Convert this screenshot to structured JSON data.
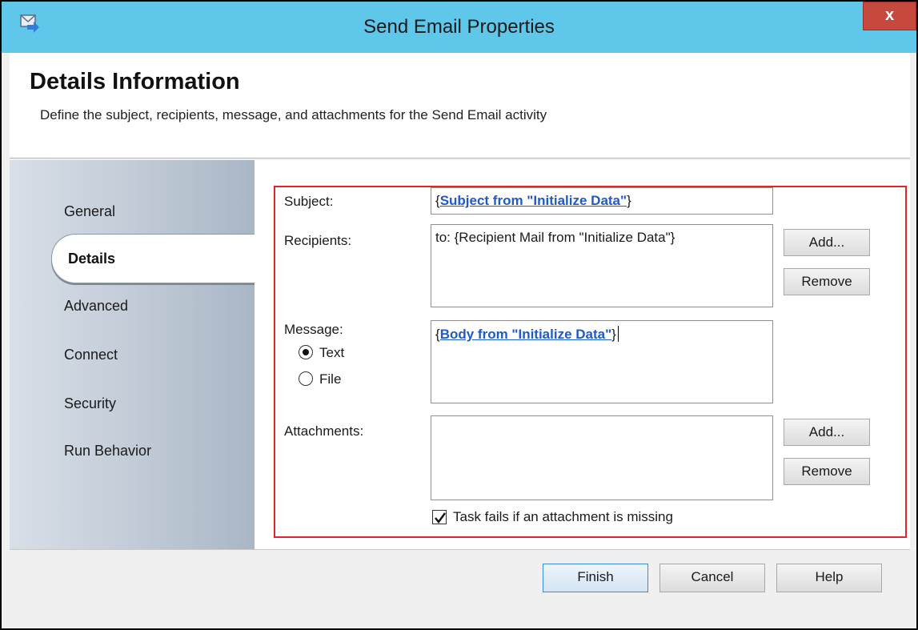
{
  "window": {
    "title": "Send Email Properties",
    "close_label": "x"
  },
  "header": {
    "title": "Details Information",
    "description": "Define the subject, recipients, message, and attachments for the Send Email activity"
  },
  "sidebar": {
    "items": [
      {
        "label": "General"
      },
      {
        "label": "Details",
        "selected": true
      },
      {
        "label": "Advanced"
      },
      {
        "label": "Connect"
      },
      {
        "label": "Security"
      },
      {
        "label": "Run Behavior"
      }
    ]
  },
  "form": {
    "subject": {
      "label": "Subject:",
      "open_brace": "{",
      "link": "Subject from \"Initialize Data\"",
      "close_brace": "}"
    },
    "recipients": {
      "label": "Recipients:",
      "value": "to: {Recipient Mail from \"Initialize Data\"}",
      "add_label": "Add...",
      "remove_label": "Remove"
    },
    "message": {
      "label": "Message:",
      "text_option": "Text",
      "file_option": "File",
      "selected": "Text",
      "open_brace": "{",
      "link": "Body from \"Initialize Data\"",
      "close_brace": "}"
    },
    "attachments": {
      "label": "Attachments:",
      "add_label": "Add...",
      "remove_label": "Remove",
      "checkbox_label": "Task fails if an attachment is missing",
      "checkbox_checked": true
    }
  },
  "footer": {
    "finish_label": "Finish",
    "cancel_label": "Cancel",
    "help_label": "Help"
  },
  "colors": {
    "titlebar": "#5fc8ea",
    "close": "#c7493d",
    "highlight_frame": "#e3222c",
    "link": "#1e5ac8"
  }
}
